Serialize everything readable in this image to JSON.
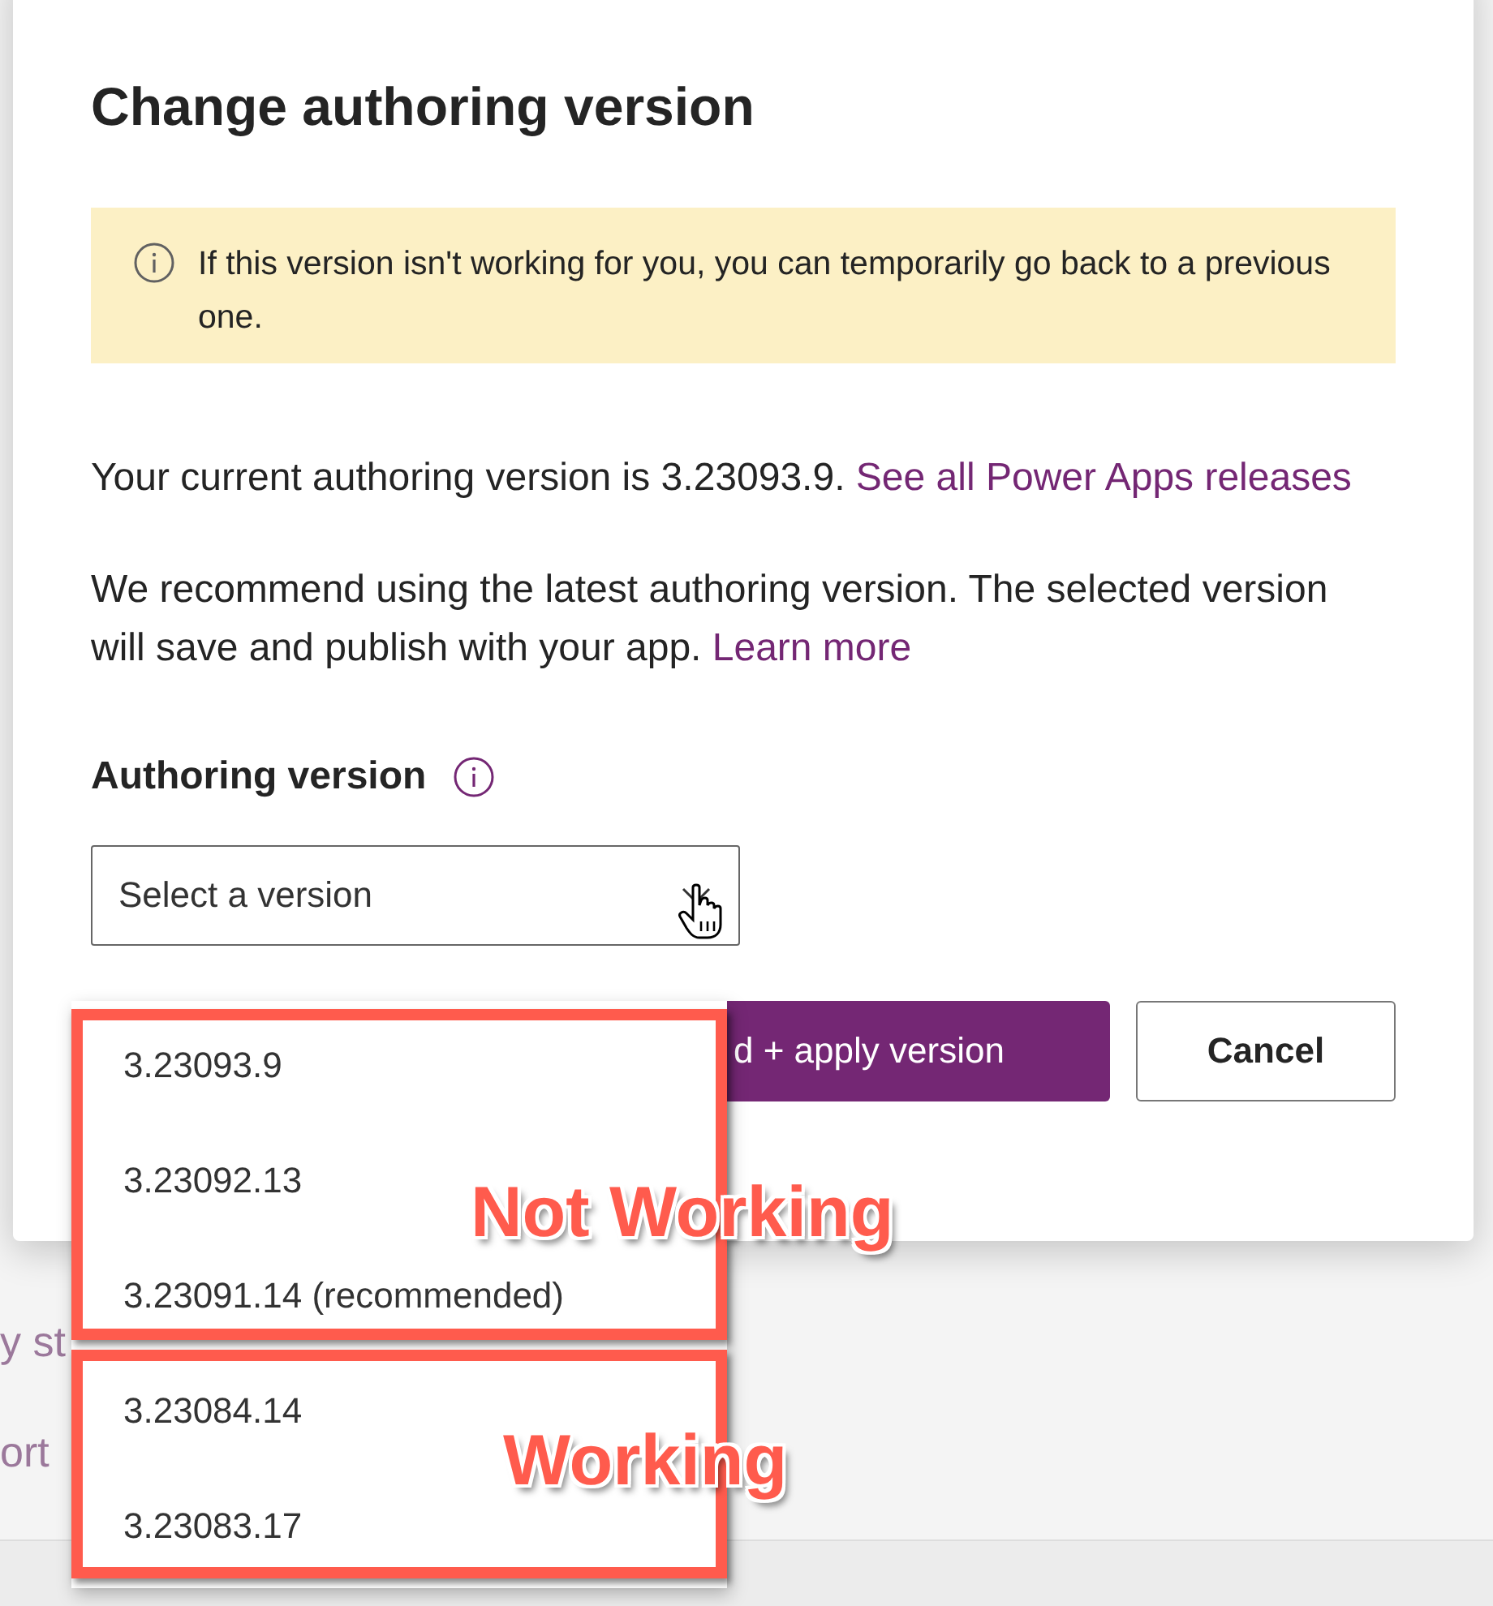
{
  "background_fragments": [
    {
      "text": "y st"
    },
    {
      "text": "ort"
    }
  ],
  "dialog": {
    "title": "Change authoring version",
    "notice": {
      "text": "If this version isn't working for you, you can temporarily go back to a previous one."
    },
    "paragraphs": [
      {
        "text": "Your current authoring version is 3.23093.9.",
        "link": "See all Power Apps releases"
      },
      {
        "text": "We recommend using the latest authoring version. The selected version will save and publish with your app.",
        "link": "Learn more"
      }
    ],
    "field": {
      "label": "Authoring version",
      "placeholder": "Select a version"
    },
    "buttons": [
      {
        "label": "d + apply version",
        "kind": "primary"
      },
      {
        "label": "Cancel",
        "kind": "secondary"
      }
    ]
  },
  "dropdown": {
    "groups": [
      {
        "annotation": "Not Working",
        "options": [
          "3.23093.9",
          "3.23092.13",
          "3.23091.14 (recommended)"
        ]
      },
      {
        "annotation": "Working",
        "options": [
          "3.23084.14",
          "3.23083.17"
        ]
      }
    ]
  }
}
